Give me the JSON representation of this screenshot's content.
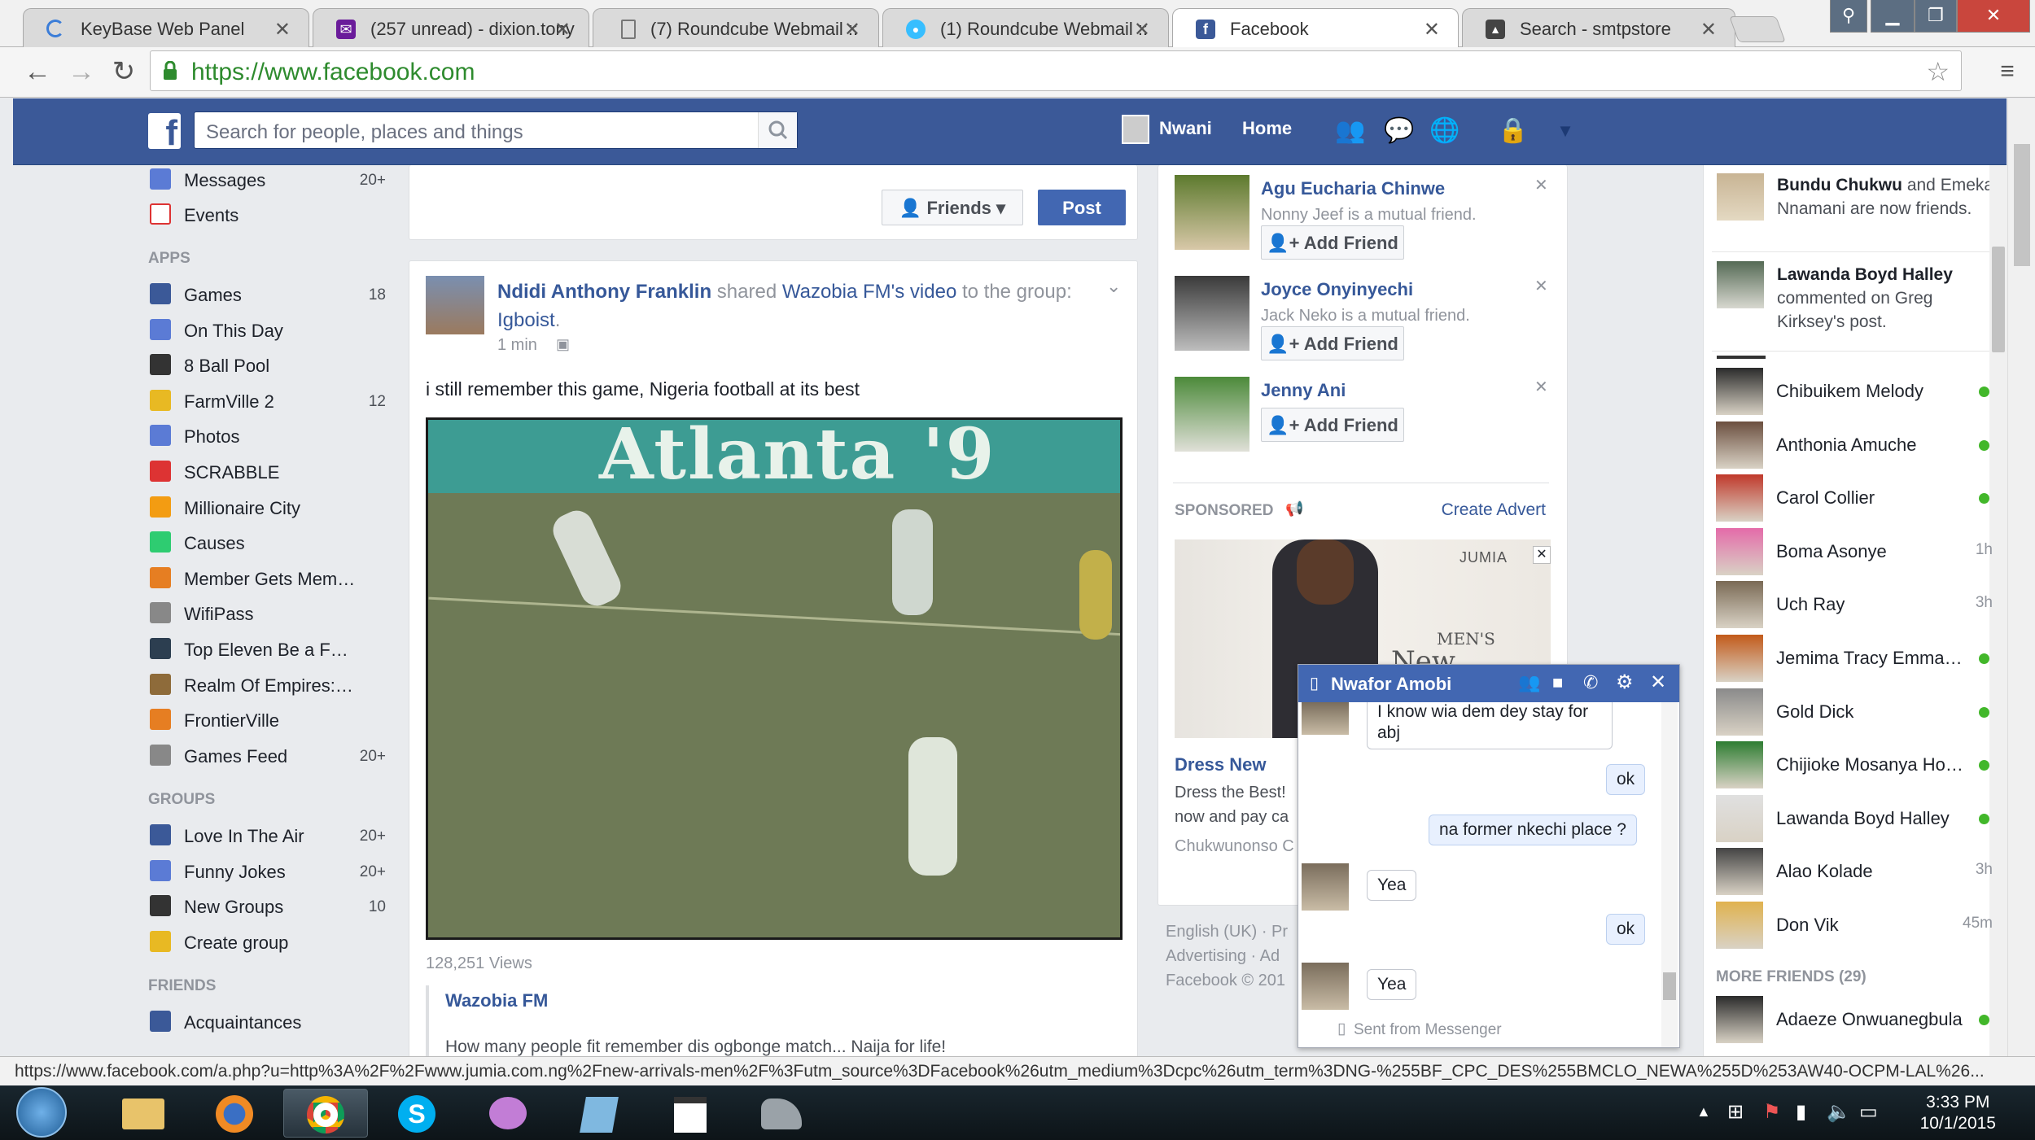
{
  "browser": {
    "tabs": [
      {
        "title": "KeyBase Web Panel",
        "icon": "loading-icon"
      },
      {
        "title": "(257 unread) - dixion.tony",
        "icon": "mail-icon"
      },
      {
        "title": "(7) Roundcube Webmail ::",
        "icon": "page-icon"
      },
      {
        "title": "(1) Roundcube Webmail ::",
        "icon": "roundcube-icon"
      },
      {
        "title": "Facebook",
        "icon": "facebook-icon"
      },
      {
        "title": "Search - smtpstore",
        "icon": "store-icon"
      }
    ],
    "url": "https://www.facebook.com",
    "status_url": "https://www.facebook.com/a.php?u=http%3A%2F%2Fwww.jumia.com.ng%2Fnew-arrivals-men%2F%3Futm_source%3DFacebook%26utm_medium%3Dcpc%26utm_term%3DNG-%255BF_CPC_DES%255BMCLO_NEWA%255D%253AW40-OCPM-LAL%26..."
  },
  "header": {
    "search_placeholder": "Search for people, places and things",
    "user_name": "Nwani",
    "home_label": "Home"
  },
  "left_nav": {
    "top_items": [
      {
        "label": "Messages",
        "count": "20+"
      },
      {
        "label": "Events",
        "count": ""
      }
    ],
    "apps_heading": "APPS",
    "apps": [
      {
        "label": "Games",
        "count": "18"
      },
      {
        "label": "On This Day",
        "count": ""
      },
      {
        "label": "8 Ball Pool",
        "count": ""
      },
      {
        "label": "FarmVille 2",
        "count": "12"
      },
      {
        "label": "Photos",
        "count": ""
      },
      {
        "label": "SCRABBLE",
        "count": ""
      },
      {
        "label": "Millionaire City",
        "count": ""
      },
      {
        "label": "Causes",
        "count": ""
      },
      {
        "label": "Member Gets Mem…",
        "count": ""
      },
      {
        "label": "WifiPass",
        "count": ""
      },
      {
        "label": "Top Eleven Be a F…",
        "count": ""
      },
      {
        "label": "Realm Of Empires:…",
        "count": ""
      },
      {
        "label": "FrontierVille",
        "count": ""
      },
      {
        "label": "Games Feed",
        "count": "20+"
      }
    ],
    "groups_heading": "GROUPS",
    "groups": [
      {
        "label": "Love In The Air",
        "count": "20+"
      },
      {
        "label": "Funny Jokes",
        "count": "20+"
      },
      {
        "label": "New Groups",
        "count": "10"
      },
      {
        "label": "Create group",
        "count": ""
      }
    ],
    "friends_heading": "FRIENDS",
    "friends": [
      {
        "label": "Acquaintances",
        "count": ""
      }
    ]
  },
  "composer": {
    "audience_label": "Friends",
    "post_label": "Post"
  },
  "post": {
    "author": "Ndidi Anthony Franklin",
    "shared_text": "shared",
    "source": "Wazobia FM",
    "source_suffix": "'s",
    "video_link": "video",
    "to_group_text": "to the group:",
    "group": "Igboist",
    "time": "1 min",
    "body": "i still remember this game, Nigeria football at its best",
    "video_caption": "Atlanta '9",
    "views": "128,251 Views",
    "page_name": "Wazobia FM",
    "description": "How many people fit remember dis ogbonge match... Naija for life!"
  },
  "people_you_may_know": [
    {
      "name": "Agu Eucharia Chinwe",
      "mutual": "Nonny Jeef is a mutual friend.",
      "button": "Add Friend"
    },
    {
      "name": "Joyce Onyinyechi",
      "mutual": "Jack Neko is a mutual friend.",
      "button": "Add Friend"
    },
    {
      "name": "Jenny Ani",
      "mutual": "",
      "button": "Add Friend"
    }
  ],
  "sponsored": {
    "heading": "SPONSORED",
    "create_advert": "Create Advert",
    "ad_brand": "JUMIA",
    "ad_line1": "MEN'S",
    "ad_line2": "New Arrivals",
    "ad_title": "Dress New",
    "ad_desc1": "Dress the Best!",
    "ad_desc2": "now and pay ca",
    "ad_source": "Chukwunonso C"
  },
  "footer_links": {
    "line1": "English (UK) · Pr",
    "line2": "Advertising · Ad",
    "line3": "Facebook © 201"
  },
  "ticker": [
    {
      "name1": "Bundu Chukwu",
      "and": "and",
      "rest": "Emeka Nnamani are now friends."
    },
    {
      "name1": "Lawanda Boyd Halley",
      "and": "",
      "rest": "commented on Greg Kirksey's post."
    }
  ],
  "chat_list": [
    {
      "name": "Chibuikem Melody",
      "status": "online"
    },
    {
      "name": "Anthonia Amuche",
      "status": "online"
    },
    {
      "name": "Carol Collier",
      "status": "online"
    },
    {
      "name": "Boma Asonye",
      "status": "1h"
    },
    {
      "name": "Uch Ray",
      "status": "3h"
    },
    {
      "name": "Jemima Tracy Emma…",
      "status": "online"
    },
    {
      "name": "Gold Dick",
      "status": "online"
    },
    {
      "name": "Chijioke Mosanya Hor…",
      "status": "online"
    },
    {
      "name": "Lawanda Boyd Halley",
      "status": "online"
    },
    {
      "name": "Alao Kolade",
      "status": "3h"
    },
    {
      "name": "Don Vik",
      "status": "45m"
    }
  ],
  "more_friends": "MORE FRIENDS (29)",
  "more_friends_list": [
    {
      "name": "Adaeze Onwuanegbula",
      "status": "online"
    }
  ],
  "chat_window": {
    "name": "Nwafor Amobi",
    "messages": [
      {
        "from": "them",
        "text": "I know wia dem dey stay for abj"
      },
      {
        "from": "me",
        "text": "ok"
      },
      {
        "from": "me",
        "text": "na former nkechi place ?"
      },
      {
        "from": "them",
        "text": "Yea"
      },
      {
        "from": "me",
        "text": "ok"
      },
      {
        "from": "them",
        "text": "Yea"
      }
    ],
    "sent_from": "Sent from Messenger"
  },
  "taskbar": {
    "time": "3:33 PM",
    "date": "10/1/2015"
  },
  "colors": {
    "facebook_blue": "#3b5998",
    "link_blue": "#365899",
    "online_green": "#42b72a",
    "chat_header": "#4267b2"
  }
}
